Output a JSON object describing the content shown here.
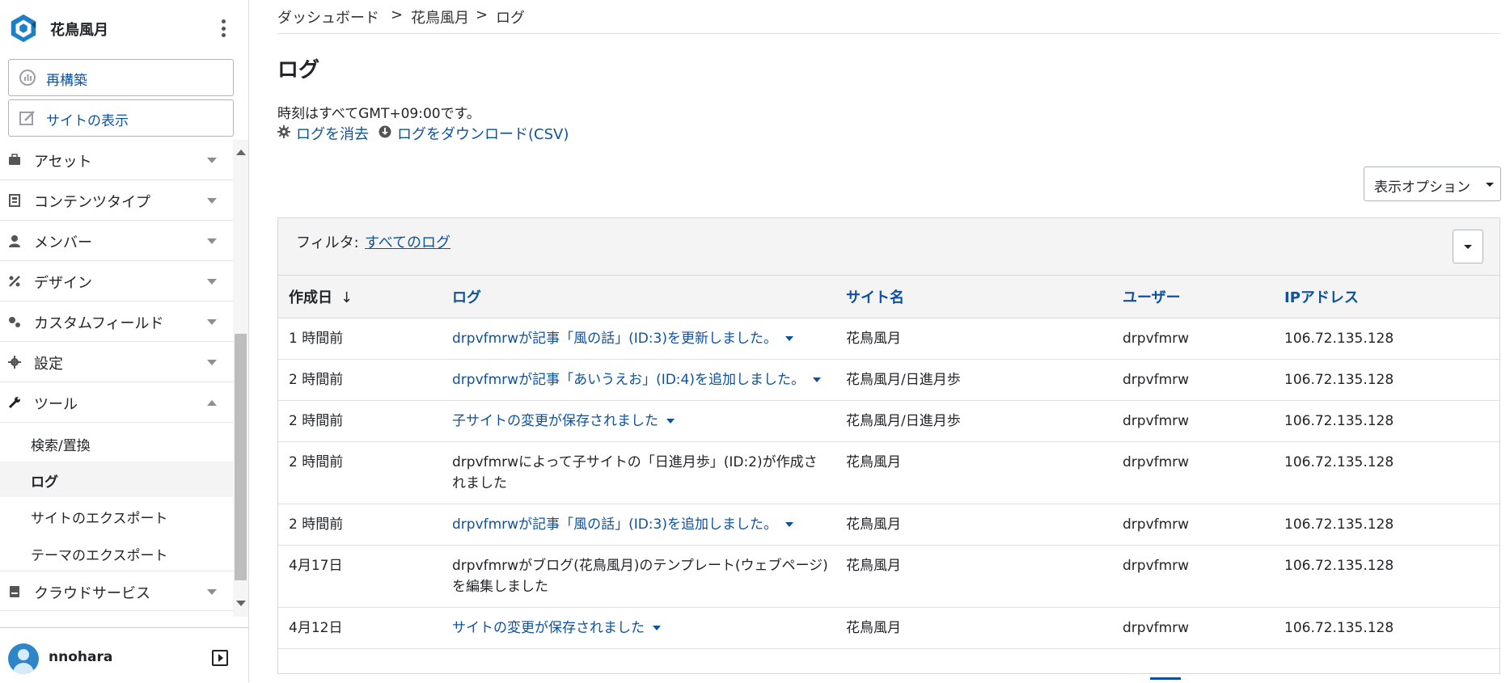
{
  "brand": {
    "name": "花鳥風月"
  },
  "sidebar": {
    "rebuild_label": "再構築",
    "view_site_label": "サイトの表示",
    "menu": [
      {
        "label": "アセット",
        "icon": "briefcase-icon"
      },
      {
        "label": "コンテンツタイプ",
        "icon": "content-type-icon"
      },
      {
        "label": "メンバー",
        "icon": "user-icon"
      },
      {
        "label": "デザイン",
        "icon": "design-icon"
      },
      {
        "label": "カスタムフィールド",
        "icon": "custom-field-icon"
      },
      {
        "label": "設定",
        "icon": "gear-icon"
      },
      {
        "label": "ツール",
        "icon": "wrench-icon"
      }
    ],
    "tools_sub": [
      "検索/置換",
      "ログ",
      "サイトのエクスポート",
      "テーマのエクスポート"
    ],
    "cloud_label": "クラウドサービス",
    "user": "nnohara"
  },
  "breadcrumb": [
    "ダッシュボード",
    ">",
    "花鳥風月",
    ">",
    "ログ"
  ],
  "page": {
    "title": "ログ",
    "tz_note": "時刻はすべてGMT+09:00です。",
    "clear_log": "ログを消去",
    "download_log": "ログをダウンロード(CSV)",
    "display_options": "表示オプション"
  },
  "filter": {
    "label": "フィルタ:",
    "value": "すべてのログ"
  },
  "table": {
    "headers": [
      "作成日",
      "ログ",
      "サイト名",
      "ユーザー",
      "IPアドレス"
    ],
    "sort_arrow": "↓",
    "rows": [
      {
        "date": "1 時間前",
        "log": "drpvfmrwが記事「風の話」(ID:3)を更新しました。",
        "link": true,
        "site": "花鳥風月",
        "user": "drpvfmrw",
        "ip": "106.72.135.128"
      },
      {
        "date": "2 時間前",
        "log": "drpvfmrwが記事「あいうえお」(ID:4)を追加しました。",
        "link": true,
        "site": "花鳥風月/日進月歩",
        "user": "drpvfmrw",
        "ip": "106.72.135.128"
      },
      {
        "date": "2 時間前",
        "log": "子サイトの変更が保存されました",
        "link": true,
        "site": "花鳥風月/日進月歩",
        "user": "drpvfmrw",
        "ip": "106.72.135.128"
      },
      {
        "date": "2 時間前",
        "log": "drpvfmrwによって子サイトの「日進月歩」(ID:2)が作成されました",
        "link": false,
        "site": "花鳥風月",
        "user": "drpvfmrw",
        "ip": "106.72.135.128"
      },
      {
        "date": "2 時間前",
        "log": "drpvfmrwが記事「風の話」(ID:3)を追加しました。",
        "link": true,
        "site": "花鳥風月",
        "user": "drpvfmrw",
        "ip": "106.72.135.128"
      },
      {
        "date": "4月17日",
        "log": "drpvfmrwがブログ(花鳥風月)のテンプレート(ウェブページ)を編集しました",
        "link": false,
        "site": "花鳥風月",
        "user": "drpvfmrw",
        "ip": "106.72.135.128"
      },
      {
        "date": "4月12日",
        "log": "サイトの変更が保存されました",
        "link": true,
        "site": "花鳥風月",
        "user": "drpvfmrw",
        "ip": "106.72.135.128"
      }
    ]
  },
  "colors": {
    "link": "#0d519f",
    "header_bg": "#f4f4f4",
    "avatar": "#2e86c9"
  }
}
